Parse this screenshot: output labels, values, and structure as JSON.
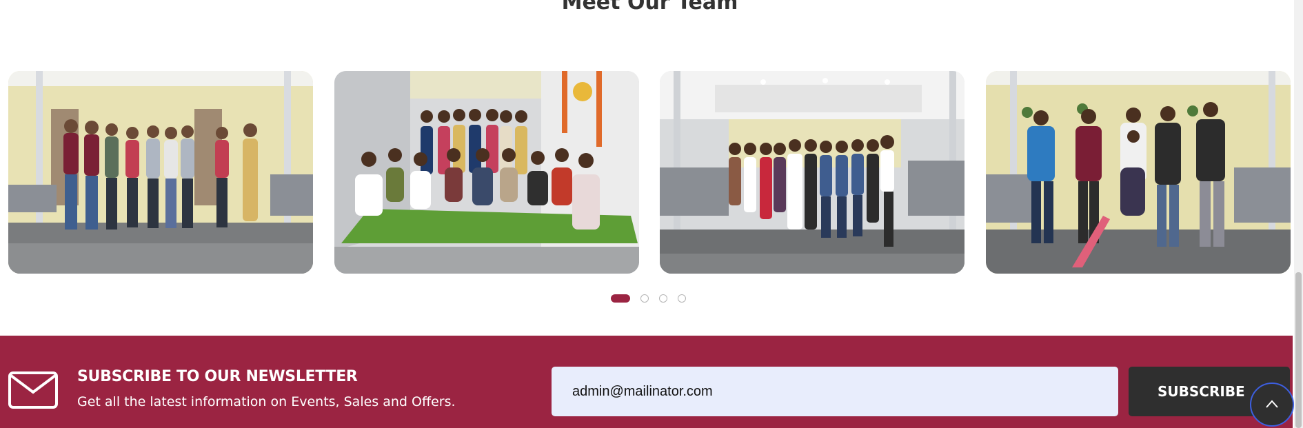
{
  "team": {
    "heading": "Meet Our Team",
    "photos": [
      {
        "name": "team-photo-office-group",
        "scene": "office"
      },
      {
        "name": "team-photo-festival-celebration",
        "scene": "festival"
      },
      {
        "name": "team-photo-large-group",
        "scene": "office-wide"
      },
      {
        "name": "team-photo-cricket",
        "scene": "cricket"
      }
    ],
    "carousel": {
      "slides": 4,
      "active": 1
    }
  },
  "newsletter": {
    "title": "SUBSCRIBE TO OUR NEWSLETTER",
    "subtitle": "Get all the latest information on Events, Sales and Offers.",
    "email_value": "admin@mailinator.com",
    "subscribe_label": "SUBSCRIBE",
    "subscribe_icon": "arrow-right-icon"
  },
  "back_to_top_icon": "chevron-up-icon",
  "colors": {
    "brand": "#9b2442",
    "heading": "#333333",
    "input_bg": "#e8edfc",
    "button_bg": "#2f2f2f"
  }
}
